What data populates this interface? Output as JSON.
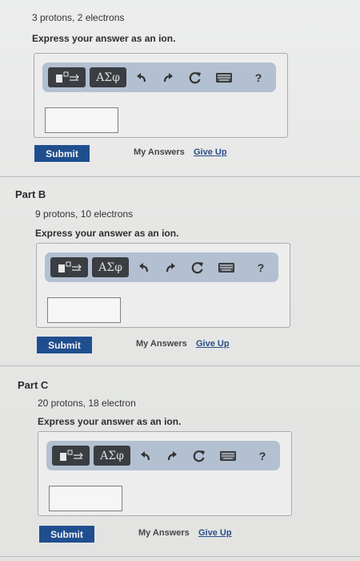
{
  "parts": [
    {
      "title": "",
      "problem": "3 protons, 2 electrons",
      "instruction": "Express your answer as an ion.",
      "answer_value": ""
    },
    {
      "title": "Part B",
      "problem": "9 protons, 10 electrons",
      "instruction": "Express your answer as an ion.",
      "answer_value": ""
    },
    {
      "title": "Part C",
      "problem": "20 protons, 18 electron",
      "instruction": "Express your answer as an ion.",
      "answer_value": ""
    }
  ],
  "toolbar": {
    "greek_label": "ΑΣφ",
    "help_label": "?",
    "icons": [
      "template-icon",
      "undo-icon",
      "redo-icon",
      "reset-icon",
      "keyboard-icon",
      "help-icon"
    ]
  },
  "actions": {
    "submit_label": "Submit",
    "my_answers_label": "My Answers",
    "give_up_label": "Give Up"
  },
  "colors": {
    "toolbar_bg": "#b3c0d1",
    "tool_button_bg": "#3a3d42",
    "submit_bg": "#1f4e8f",
    "link_color": "#2b4e86"
  }
}
